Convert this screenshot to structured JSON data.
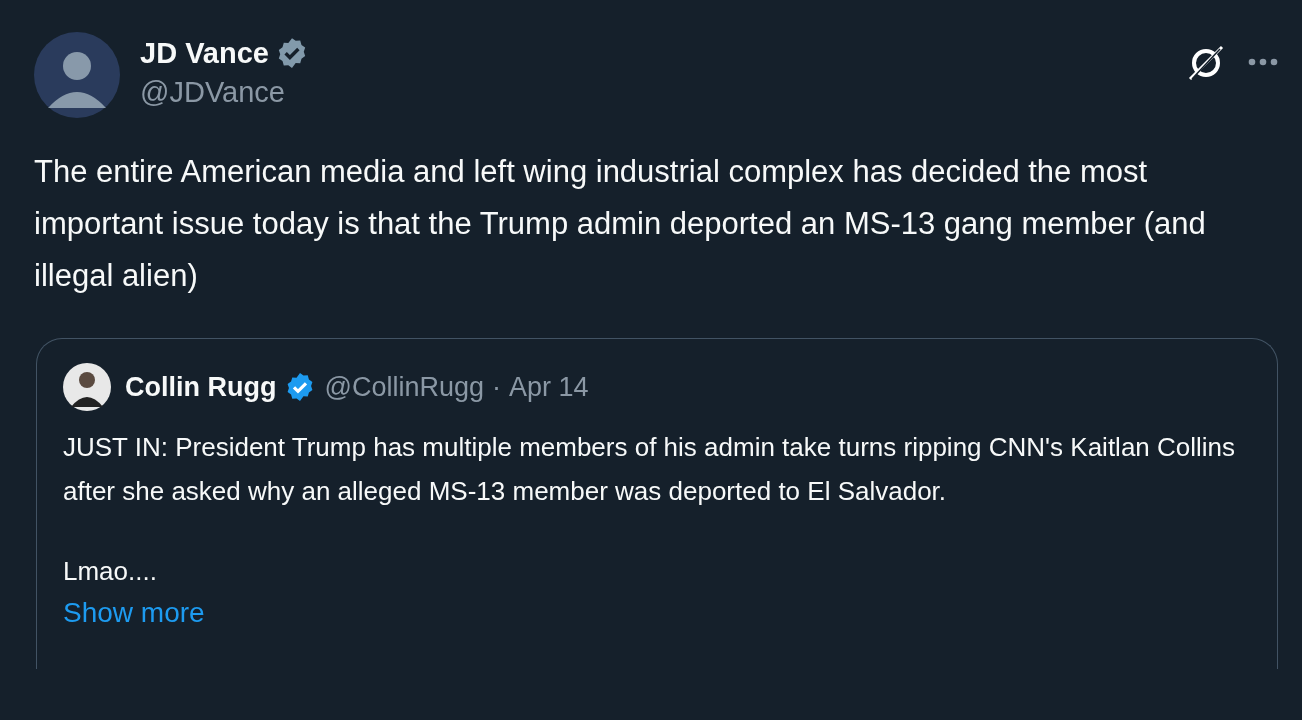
{
  "author": {
    "name": "JD Vance",
    "handle": "@JDVance",
    "badge": {
      "color": "#829aab"
    }
  },
  "text": "The entire American media and left wing industrial complex has decided the most important issue today is that the Trump admin deported an MS-13 gang member (and illegal alien)",
  "quoted": {
    "author": {
      "name": "Collin Rugg",
      "handle": "@CollinRugg",
      "badge": {
        "color": "#1d9bf0"
      }
    },
    "separator": "·",
    "date": "Apr 14",
    "paragraphs": [
      "JUST IN: President Trump has multiple members of his admin take turns ripping CNN's Kaitlan Collins after she asked why an alleged MS-13 member was deported to El Salvador.",
      "Lmao...."
    ],
    "show_more": "Show more"
  }
}
